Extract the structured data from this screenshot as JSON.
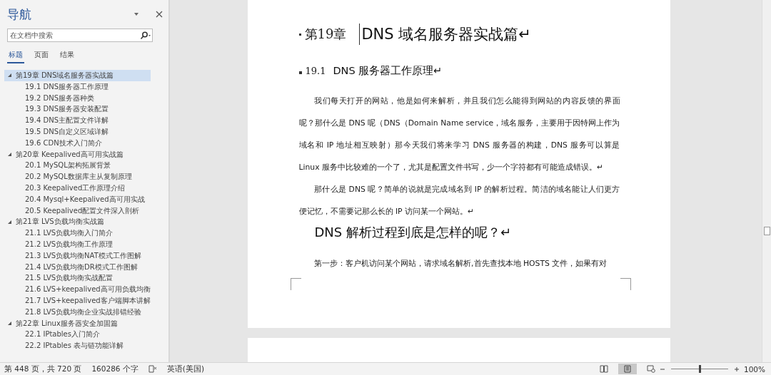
{
  "navigation": {
    "title": "导航",
    "search": {
      "placeholder": "在文档中搜索"
    },
    "tabs": [
      {
        "label": "标题",
        "selected": true
      },
      {
        "label": "页面",
        "selected": false
      },
      {
        "label": "结果",
        "selected": false
      }
    ],
    "headings": [
      {
        "label": "第19章  DNS域名服务器实战篇",
        "selected": true,
        "expanded": true,
        "children": [
          {
            "label": "19.1  DNS服务器工作原理",
            "selected": false
          },
          {
            "label": "19.2  DNS服务器种类",
            "selected": false
          },
          {
            "label": "19.3  DNS服务器安装配置",
            "selected": false
          },
          {
            "label": "19.4  DNS主配置文件详解",
            "selected": false
          },
          {
            "label": "19.5  DNS自定义区域详解",
            "selected": false
          },
          {
            "label": "19.6  CDN技术入门简介",
            "selected": false
          }
        ]
      },
      {
        "label": "第20章  Keepalived高可用实战篇",
        "selected": false,
        "expanded": true,
        "children": [
          {
            "label": "20.1  MySQL架构拓展背景",
            "selected": false
          },
          {
            "label": "20.2  MySQL数据库主从复制原理",
            "selected": false
          },
          {
            "label": "20.3  Keepalived工作原理介绍",
            "selected": false
          },
          {
            "label": "20.4  Mysql+Keepalived高可用实战",
            "selected": false
          },
          {
            "label": "20.5  Keepalived配置文件深入剖析",
            "selected": false
          }
        ]
      },
      {
        "label": "第21章  LVS负载均衡实战篇",
        "selected": false,
        "expanded": true,
        "children": [
          {
            "label": "21.1  LVS负载均衡入门简介",
            "selected": false
          },
          {
            "label": "21.2  LVS负载均衡工作原理",
            "selected": false
          },
          {
            "label": "21.3  LVS负载均衡NAT模式工作图解",
            "selected": false
          },
          {
            "label": "21.4  LVS负载均衡DR模式工作图解",
            "selected": false
          },
          {
            "label": "21.5  LVS负载均衡实战配置",
            "selected": false
          },
          {
            "label": "21.6  LVS+keepalived高可用负载均衡",
            "selected": false
          },
          {
            "label": "21.7  LVS+keepalived客户端脚本讲解",
            "selected": false
          },
          {
            "label": "21.8  LVS负载均衡企业实战排错经验",
            "selected": false
          }
        ]
      },
      {
        "label": "第22章  Linux服务器安全加固篇",
        "selected": false,
        "expanded": true,
        "children": [
          {
            "label": "22.1  IPtables入门简介",
            "selected": false
          },
          {
            "label": "22.2  IPtables 表与链功能详解",
            "selected": false
          }
        ]
      }
    ]
  },
  "document": {
    "blocks": [
      {
        "kind": "chapter",
        "number": "第19章",
        "text": "DNS 域名服务器实战篇↵"
      },
      {
        "kind": "section",
        "number": "19.1",
        "text": "DNS 服务器工作原理↵"
      },
      {
        "kind": "paragraph",
        "text": "我们每天打开的网站，他是如何来解析，并且我们怎么能得到网站的内容反馈的界面呢？那什么是 DNS 呢（DNS（Domain Name service，域名服务，主要用于因特网上作为域名和 IP 地址相互映射）那今天我们将来学习 DNS 服务器的构建，DNS 服务可以算是 Linux 服务中比较难的一个了，尤其是配置文件书写，少一个字符都有可能造成错误。↵"
      },
      {
        "kind": "paragraph",
        "text": "那什么是 DNS 呢？简单的说就是完成域名到 IP 的解析过程。简洁的域名能让人们更方便记忆，不需要记那么长的 IP 访问某一个网站。↵"
      },
      {
        "kind": "subheading",
        "text": "DNS 解析过程到底是怎样的呢？↵"
      },
      {
        "kind": "paragraph",
        "text": "第一步：客户机访问某个网站，请求域名解析,首先查找本地  HOSTS  文件，如果有对"
      }
    ]
  },
  "status_bar": {
    "page": "第 448 页，共 720 页",
    "words": "160286 个字",
    "language": "英语(美国)",
    "zoom": {
      "level": 0.5
    },
    "zoom_percent": "100%"
  }
}
